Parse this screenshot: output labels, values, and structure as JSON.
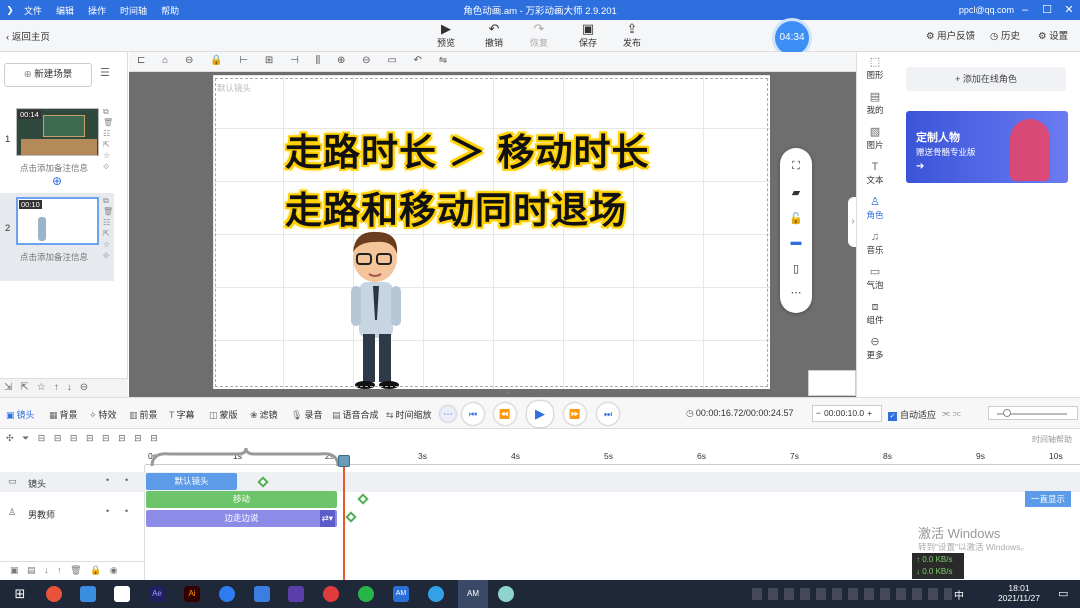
{
  "app": {
    "title": "角色动画.am - 万彩动画大师 2.9.201",
    "menu": [
      "文件",
      "编辑",
      "操作",
      "时间轴",
      "帮助"
    ],
    "user": "ppcl@qq.com"
  },
  "toolbar": {
    "back_label": "返回主页",
    "preview": "预览",
    "undo": "撤销",
    "redo": "恢复",
    "save": "保存",
    "publish": "发布",
    "timer": "04:34",
    "feedback": "用户反馈",
    "history": "历史",
    "settings": "设置"
  },
  "scenes": {
    "new_scene": "新建场景",
    "items": [
      {
        "num": "1",
        "time": "00:14",
        "note": "点击添加备注信息"
      },
      {
        "num": "2",
        "time": "00:10",
        "note": "点击添加备注信息"
      }
    ]
  },
  "stage": {
    "camera_label": "默认镜头",
    "line1": "走路时长 ＞ 移动时长",
    "line2": "走路和移动同时退场"
  },
  "vtabs": [
    "图形",
    "我的",
    "图片",
    "文本",
    "角色",
    "音乐",
    "气泡",
    "组件",
    "更多"
  ],
  "rpanel": {
    "add_online": "添加在线角色",
    "banner_title": "定制人物",
    "banner_sub": "赠送骨骼专业版"
  },
  "timeline_toolbar": {
    "items": [
      "镜头",
      "背景",
      "特效",
      "前景",
      "字幕",
      "蒙版",
      "滤镜",
      "录音",
      "语音合成",
      "时间缩放"
    ],
    "time_display": "00:00:16.72/00:00:24.57",
    "duration_value": "00:00:10.0",
    "auto_fit": "自动适应",
    "help": "时间轴帮助"
  },
  "ruler": [
    "0s",
    "1s",
    "2s",
    "3s",
    "4s",
    "5s",
    "6s",
    "7s",
    "8s",
    "9s",
    "10s"
  ],
  "tracks": [
    {
      "name": "镜头",
      "clip": "默认镜头"
    },
    {
      "name": "男教师",
      "clip": "移动",
      "clip2": "边走边说"
    }
  ],
  "always_show": "一直显示",
  "watermark": {
    "line1": "激活 Windows",
    "line2": "转到\"设置\"以激活 Windows。"
  },
  "net": {
    "up": "0.0 KB/s",
    "down": "0.0 KB/s"
  },
  "clock": {
    "time": "18:01",
    "date": "2021/11/27"
  },
  "ime": "中"
}
